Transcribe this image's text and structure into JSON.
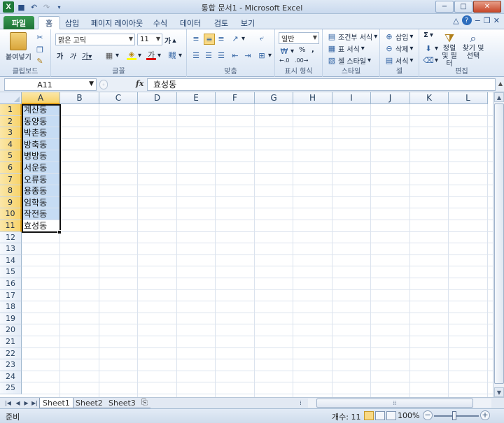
{
  "window": {
    "title": "통합 문서1 - Microsoft Excel",
    "controls": [
      "−",
      "□",
      "✕"
    ]
  },
  "ribbon_tabs": [
    "파일",
    "홈",
    "삽입",
    "페이지 레이아웃",
    "수식",
    "데이터",
    "검토",
    "보기"
  ],
  "active_tab": "홈",
  "ribbon": {
    "clipboard": {
      "paste": "붙여넣기",
      "label": "클립보드"
    },
    "font": {
      "name": "맑은 고딕",
      "size": "11",
      "label": "글꼴"
    },
    "alignment": {
      "label": "맞춤"
    },
    "number": {
      "format": "일반",
      "percent": "%",
      "comma": ",",
      "label": "표시 형식"
    },
    "styles": {
      "conditional": "조건부 서식",
      "table": "표 서식",
      "cell": "셀 스타일",
      "label": "스타일"
    },
    "cells": {
      "insert": "삽입",
      "delete": "삭제",
      "format": "서식",
      "label": "셀"
    },
    "editing": {
      "sum": "Σ",
      "sort": "정렬 및 필터",
      "find": "찾기 및 선택",
      "label": "편집"
    }
  },
  "formula_bar": {
    "name_box": "A11",
    "fx": "fx",
    "content": "효성동"
  },
  "columns": [
    "A",
    "B",
    "C",
    "D",
    "E",
    "F",
    "G",
    "H",
    "I",
    "J",
    "K",
    "L"
  ],
  "rows": [
    "1",
    "2",
    "3",
    "4",
    "5",
    "6",
    "7",
    "8",
    "9",
    "10",
    "11",
    "12",
    "13",
    "14",
    "15",
    "16",
    "17",
    "18",
    "19",
    "20",
    "21",
    "22",
    "23",
    "24",
    "25"
  ],
  "cells_A": [
    "계산동",
    "동양동",
    "박촌동",
    "방축동",
    "병방동",
    "서운동",
    "오류동",
    "용종동",
    "임학동",
    "작전동",
    "효성동"
  ],
  "sheets": [
    "Sheet1",
    "Sheet2",
    "Sheet3"
  ],
  "active_sheet": "Sheet1",
  "status": {
    "ready": "준비",
    "count": "개수: 11",
    "zoom": "100%"
  }
}
